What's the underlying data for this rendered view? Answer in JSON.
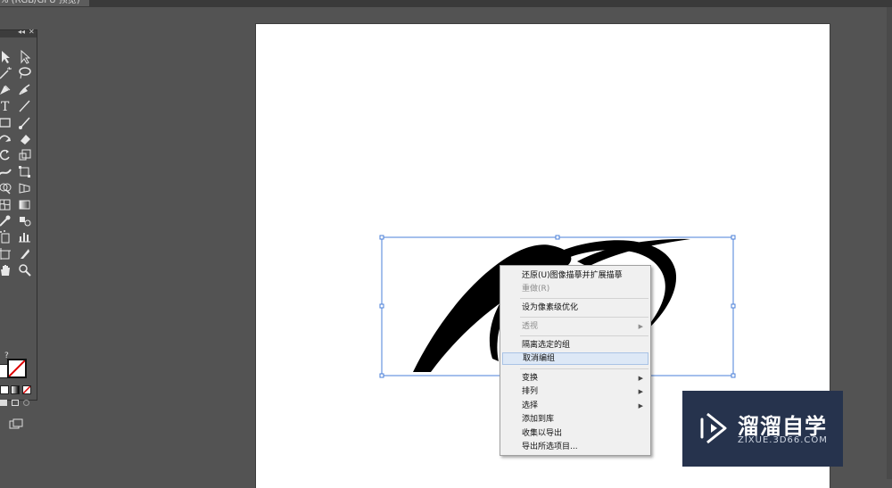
{
  "document": {
    "tab_title": "% (RGB/GPU 预览)"
  },
  "tools_panel": {
    "collapse_label": "◂◂",
    "close_label": "✕",
    "tools": [
      {
        "left": "selection-tool-icon",
        "right": "direct-selection-tool-icon"
      },
      {
        "left": "magic-wand-tool-icon",
        "right": "lasso-tool-icon"
      },
      {
        "left": "pen-tool-icon",
        "right": "curvature-tool-icon"
      },
      {
        "left": "type-tool-icon",
        "right": "line-segment-tool-icon"
      },
      {
        "left": "rectangle-tool-icon",
        "right": "paintbrush-tool-icon"
      },
      {
        "left": "shaper-tool-icon",
        "right": "eraser-tool-icon"
      },
      {
        "left": "rotate-tool-icon",
        "right": "scale-tool-icon"
      },
      {
        "left": "width-tool-icon",
        "right": "free-transform-tool-icon"
      },
      {
        "left": "shape-builder-tool-icon",
        "right": "perspective-grid-tool-icon"
      },
      {
        "left": "mesh-tool-icon",
        "right": "gradient-tool-icon"
      },
      {
        "left": "eyedropper-tool-icon",
        "right": "blend-tool-icon"
      },
      {
        "left": "symbol-sprayer-tool-icon",
        "right": "column-graph-tool-icon"
      },
      {
        "left": "artboard-tool-icon",
        "right": "slice-tool-icon"
      },
      {
        "left": "hand-tool-icon",
        "right": "zoom-tool-icon"
      }
    ],
    "help_label": "?"
  },
  "context_menu": {
    "items": [
      {
        "label": "还原(U)图像描摹并扩展描摹",
        "disabled": false
      },
      {
        "label": "重做(R)",
        "disabled": true
      },
      {
        "label": "设为像素级优化",
        "disabled": false
      },
      {
        "label": "透视",
        "disabled": true,
        "submenu": true
      },
      {
        "label": "隔离选定的组",
        "disabled": false
      },
      {
        "label": "取消编组",
        "disabled": false,
        "highlighted": true
      },
      {
        "label": "变换",
        "disabled": false,
        "submenu": true
      },
      {
        "label": "排列",
        "disabled": false,
        "submenu": true
      },
      {
        "label": "选择",
        "disabled": false,
        "submenu": true
      },
      {
        "label": "添加到库",
        "disabled": false
      },
      {
        "label": "收集以导出",
        "disabled": false
      },
      {
        "label": "导出所选项目...",
        "disabled": false
      }
    ],
    "submenu_arrow": "▶"
  },
  "watermark": {
    "title": "溜溜自学",
    "subtitle": "ZIXUE.3D66.COM"
  },
  "colors": {
    "background": "#535353",
    "artboard": "#ffffff",
    "selection": "#4a7fd8",
    "menu_highlight": "#dde8f6",
    "watermark_bg": "#26334d"
  }
}
